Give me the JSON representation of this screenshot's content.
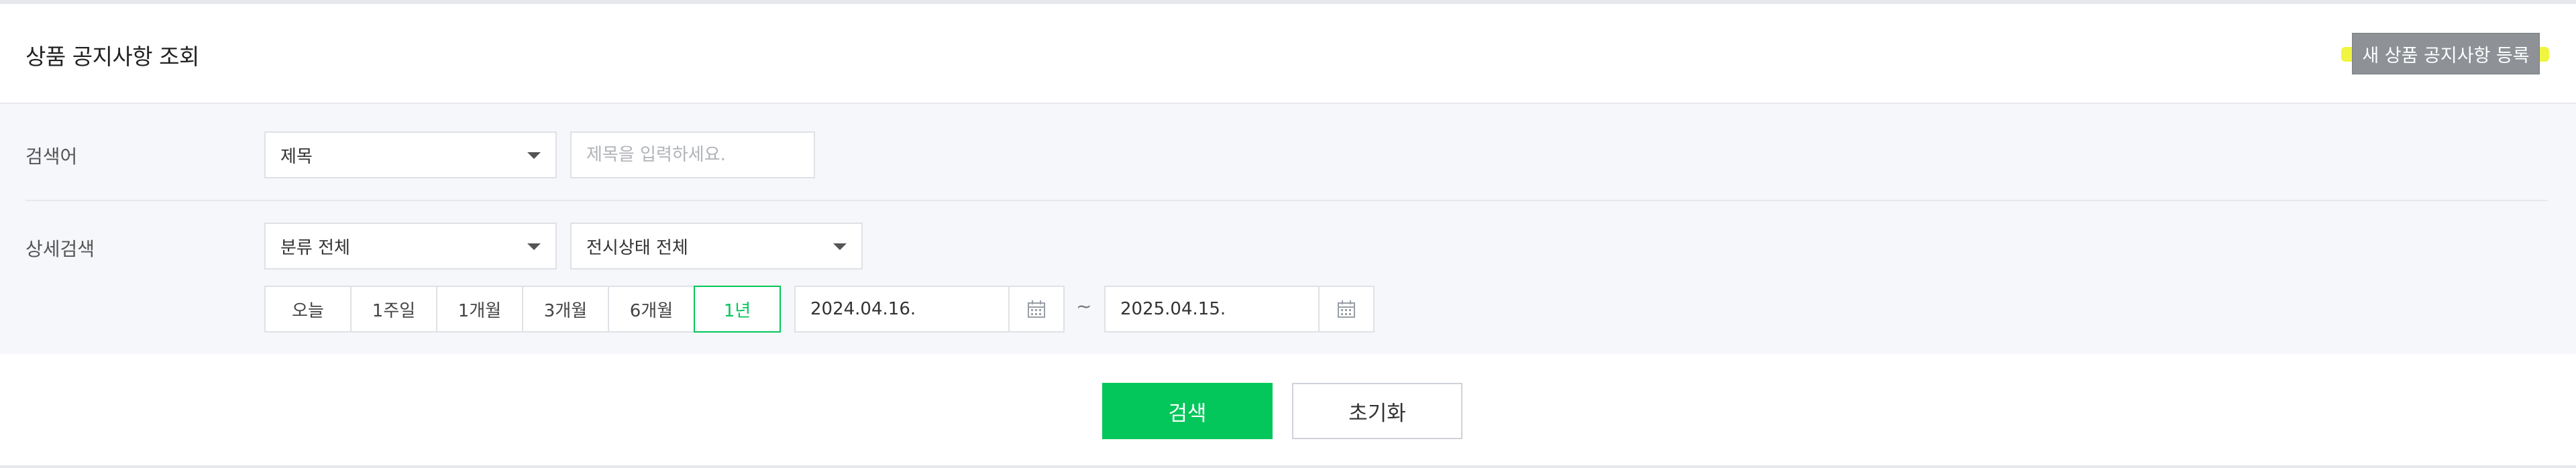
{
  "header": {
    "title": "상품 공지사항 조회",
    "register_label": "새 상품 공지사항 등록"
  },
  "search": {
    "keyword_label": "검색어",
    "keyword_type": "제목",
    "keyword_placeholder": "제목을 입력하세요.",
    "detail_label": "상세검색",
    "category": "분류 전체",
    "display_status": "전시상태 전체",
    "periods": [
      "오늘",
      "1주일",
      "1개월",
      "3개월",
      "6개월",
      "1년"
    ],
    "active_period": "1년",
    "start_date": "2024.04.16.",
    "end_date": "2025.04.15.",
    "range_separator": "~"
  },
  "actions": {
    "search_label": "검색",
    "reset_label": "초기화"
  },
  "colors": {
    "accent": "#03c75a",
    "register_button": "#8e9196",
    "highlight": "#e9f200"
  }
}
